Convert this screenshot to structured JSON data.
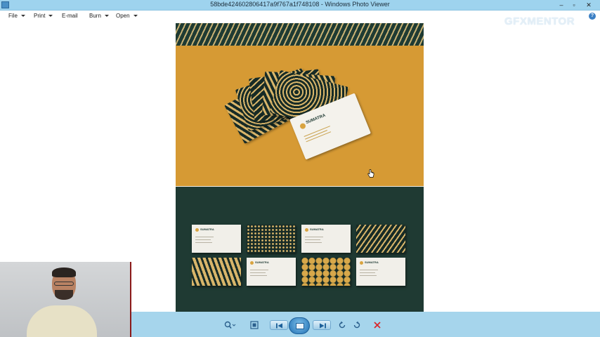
{
  "window": {
    "title": "58bde424602806417a9f767a1f748108 - Windows Photo Viewer",
    "minimize_glyph": "–",
    "maximize_glyph": "▫",
    "close_glyph": "✕"
  },
  "menu": {
    "items": [
      {
        "label": "File",
        "has_dropdown": true
      },
      {
        "label": "Print",
        "has_dropdown": true
      },
      {
        "label": "E-mail",
        "has_dropdown": false
      },
      {
        "label": "Burn",
        "has_dropdown": true
      },
      {
        "label": "Open",
        "has_dropdown": true
      }
    ],
    "help_glyph": "?"
  },
  "watermark": {
    "text": "GFXMENTOR"
  },
  "photo": {
    "card_brand": "SUMATRA",
    "colors": {
      "gold": "#d69a34",
      "dark_green": "#1f3a33",
      "cream": "#d8b56a"
    }
  },
  "toolbar": {
    "zoom_icon": "magnifier-icon",
    "fit_icon": "actual-size-icon",
    "prev_icon": "previous-icon",
    "slideshow_icon": "slideshow-icon",
    "next_icon": "next-icon",
    "rotate_ccw_icon": "rotate-counterclockwise-icon",
    "rotate_cw_icon": "rotate-clockwise-icon",
    "delete_icon": "delete-icon"
  }
}
